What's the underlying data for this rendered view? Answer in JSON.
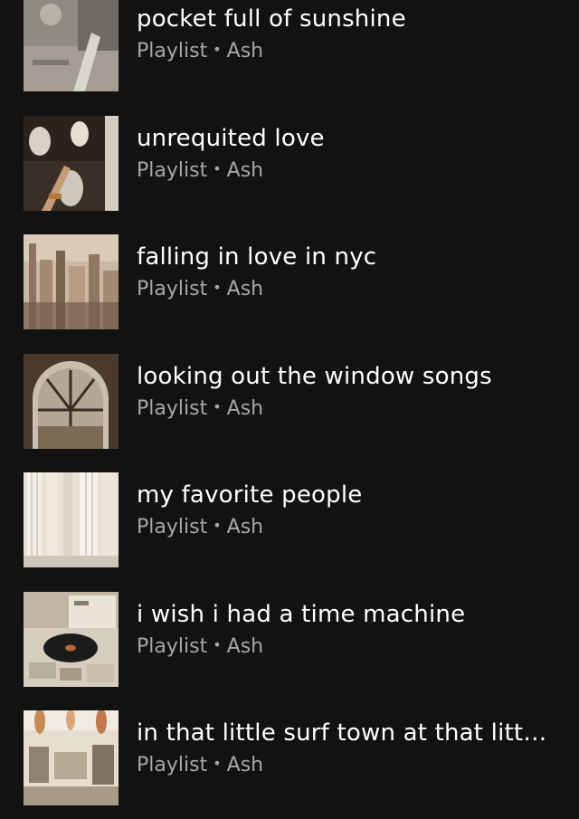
{
  "playlists": [
    {
      "title": "pocket full of sunshine",
      "type": "Playlist",
      "separator": "•",
      "owner": "Ash",
      "cover_icon": "sunshine-photo-thumbnail"
    },
    {
      "title": "unrequited love",
      "type": "Playlist",
      "separator": "•",
      "owner": "Ash",
      "cover_icon": "statue-hands-thumbnail"
    },
    {
      "title": "falling in love in nyc",
      "type": "Playlist",
      "separator": "•",
      "owner": "Ash",
      "cover_icon": "city-skyline-thumbnail"
    },
    {
      "title": "looking out the window songs",
      "type": "Playlist",
      "separator": "•",
      "owner": "Ash",
      "cover_icon": "arched-window-thumbnail"
    },
    {
      "title": "my favorite people",
      "type": "Playlist",
      "separator": "•",
      "owner": "Ash",
      "cover_icon": "white-columns-thumbnail"
    },
    {
      "title": "i wish i had a time machine",
      "type": "Playlist",
      "separator": "•",
      "owner": "Ash",
      "cover_icon": "record-player-thumbnail"
    },
    {
      "title": "in that little surf town at that littl...",
      "type": "Playlist",
      "separator": "•",
      "owner": "Ash",
      "cover_icon": "surf-shop-thumbnail"
    }
  ]
}
